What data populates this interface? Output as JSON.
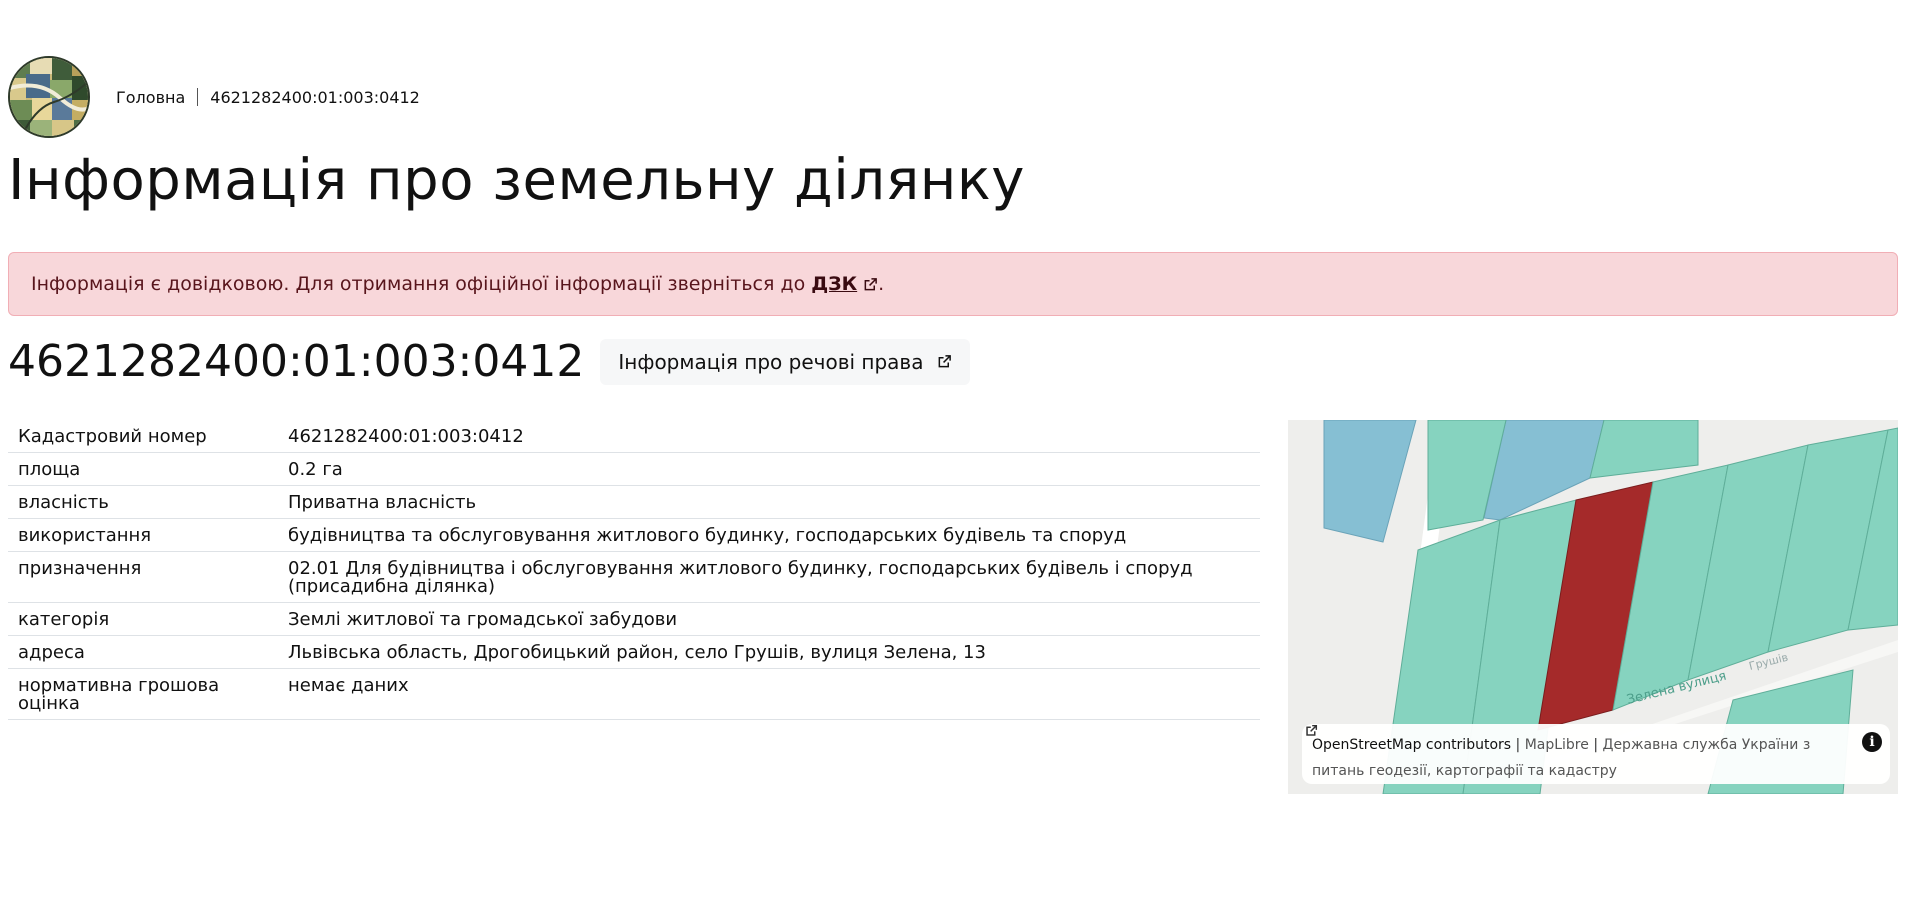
{
  "breadcrumb": {
    "home": "Головна",
    "current": "4621282400:01:003:0412"
  },
  "page_title": "Інформація про земельну ділянку",
  "alert": {
    "text": "Інформація є довідковою. Для отримання офіційної інформації зверніться до",
    "link": "ДЗК",
    "suffix": "."
  },
  "parcel": {
    "id": "4621282400:01:003:0412",
    "rights_button": "Інформація про речові права"
  },
  "details": [
    {
      "key": "Кадастровий номер",
      "value": "4621282400:01:003:0412"
    },
    {
      "key": "площа",
      "value": "0.2 га"
    },
    {
      "key": "власність",
      "value": "Приватна власність"
    },
    {
      "key": "використання",
      "value": "будівництва та обслуговування житлового будинку, господарських будівель та споруд"
    },
    {
      "key": "призначення",
      "value": "02.01 Для будівництва і обслуговування житлового будинку, господарських будівель і споруд (присадибна ділянка)"
    },
    {
      "key": "категорія",
      "value": "Землі житлової та громадської забудови"
    },
    {
      "key": "адреса",
      "value": "Львівська область, Дрогобицький район, село Грушів, вулиця Зелена, 13"
    },
    {
      "key": "нормативна грошова оцінка",
      "value": "немає даних"
    }
  ],
  "map": {
    "street_label": "Зелена вулиця",
    "street_label_2": "Грушів",
    "attribution": {
      "osm": "OpenStreetMap contributors",
      "sep1": "|",
      "maplibre": "MapLibre",
      "sep2": "|",
      "dzk": "Державна служба України з питань геодезії, картографії та кадастру"
    },
    "info_icon": "i",
    "colors": {
      "parcel_highlight": "#a52a2a",
      "parcel_fill": "#86d3bf",
      "building_fill": "#86bfd3",
      "background": "#eeeeec"
    }
  }
}
